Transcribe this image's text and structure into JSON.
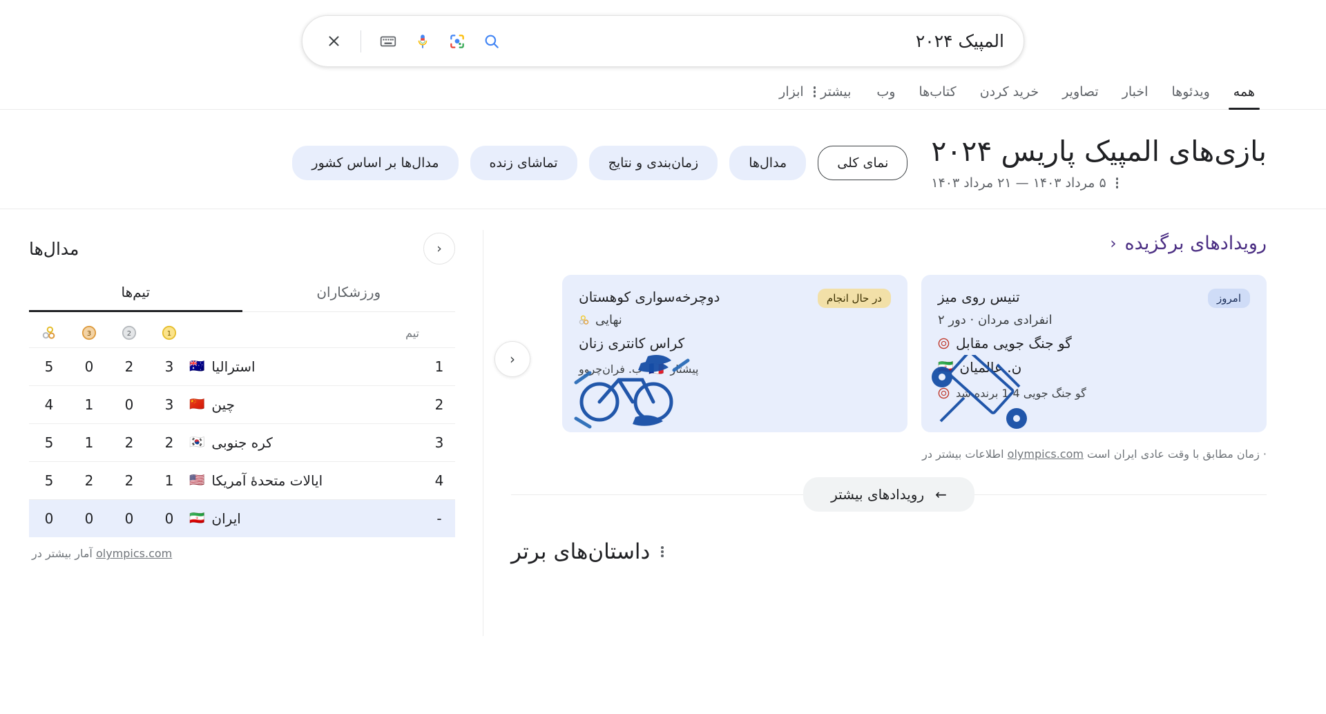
{
  "search": {
    "query": "المپیک ۲۰۲۴",
    "icons": {
      "search": "search-icon",
      "lens": "google-lens-icon",
      "mic": "microphone-icon",
      "keyboard": "keyboard-icon",
      "clear": "close-icon"
    }
  },
  "nav": {
    "tabs": [
      {
        "label": "همه",
        "active": true
      },
      {
        "label": "ویدئوها",
        "active": false
      },
      {
        "label": "اخبار",
        "active": false
      },
      {
        "label": "تصاویر",
        "active": false
      },
      {
        "label": "خرید کردن",
        "active": false
      },
      {
        "label": "کتاب‌ها",
        "active": false
      },
      {
        "label": "وب",
        "active": false
      }
    ],
    "more_label": "بیشتر",
    "tools_label": "ابزار"
  },
  "header": {
    "title": "بازی‌های المپیک پاریس ۲۰۲۴",
    "dates": "۵ مرداد ۱۴۰۳ — ۲۱ مرداد ۱۴۰۳",
    "chips": [
      {
        "label": "نمای کلی",
        "selected": true
      },
      {
        "label": "مدال‌ها",
        "selected": false
      },
      {
        "label": "زمان‌بندی و نتایج",
        "selected": false
      },
      {
        "label": "تماشای زنده",
        "selected": false
      },
      {
        "label": "مدال‌ها بر اساس کشور",
        "selected": false
      }
    ]
  },
  "featured": {
    "section_title": "رویدادهای برگزیده",
    "cards": [
      {
        "sport": "دوچرخه‌سواری کوهستان",
        "badge": "در حال انجام",
        "badge_state": "live",
        "round": "نهایی",
        "event": "کراس کانتری زنان",
        "foot_label": "پیشتاز",
        "foot_athlete": "ب. فران‌چروو",
        "foot_flag": "🇫🇷",
        "art": "mountain-bike-icon"
      },
      {
        "sport": "تنیس روی میز",
        "badge": "امروز",
        "badge_state": "today",
        "round": "انفرادی مردان · دور ۲",
        "player_one": "گو جنگ جویی مقابل",
        "player_two": "ن. عالمیان",
        "player_two_flag": "🇮🇷",
        "result": "گو جنگ جویی 4-1 برنده شد",
        "art": "table-tennis-icon"
      }
    ],
    "source_prefix": "اطلاعات بیشتر در",
    "source_link": "olympics.com",
    "source_suffix": "· زمان مطابق با وقت عادی ایران است",
    "more_events": "رویدادهای بیشتر",
    "prev_label": "قبلی"
  },
  "top_stories": {
    "title": "داستان‌های برتر"
  },
  "medals": {
    "title": "مدال‌ها",
    "back_label": "قبلی",
    "tabs": [
      {
        "label": "تیم‌ها",
        "active": true
      },
      {
        "label": "ورزشکاران",
        "active": false
      }
    ],
    "columns": {
      "team": "تیم",
      "gold": "۱",
      "silver": "۲",
      "bronze": "۳",
      "total": "مجموع"
    },
    "rows": [
      {
        "rank": "1",
        "team": "استرالیا",
        "flag": "🇦🇺",
        "gold": "3",
        "silver": "2",
        "bronze": "0",
        "total": "5",
        "highlight": false
      },
      {
        "rank": "2",
        "team": "چین",
        "flag": "🇨🇳",
        "gold": "3",
        "silver": "0",
        "bronze": "1",
        "total": "4",
        "highlight": false
      },
      {
        "rank": "3",
        "team": "کره جنوبی",
        "flag": "🇰🇷",
        "gold": "2",
        "silver": "2",
        "bronze": "1",
        "total": "5",
        "highlight": false
      },
      {
        "rank": "4",
        "team": "ایالات متحدهٔ آمریکا",
        "flag": "🇺🇸",
        "gold": "1",
        "silver": "2",
        "bronze": "2",
        "total": "5",
        "highlight": false
      },
      {
        "rank": "-",
        "team": "ایران",
        "flag": "🇮🇷",
        "gold": "0",
        "silver": "0",
        "bronze": "0",
        "total": "0",
        "highlight": true
      }
    ],
    "source_prefix": "آمار بیشتر در",
    "source_link": "olympics.com"
  },
  "colors": {
    "gold": "#f2ca2f",
    "silver": "#c0c3c7",
    "bronze": "#e2a13a",
    "chip_bg": "#e8eefc",
    "link_purple": "#4b2e83",
    "badge_live": "#f2e0a8",
    "badge_today": "#cfdcf7"
  }
}
